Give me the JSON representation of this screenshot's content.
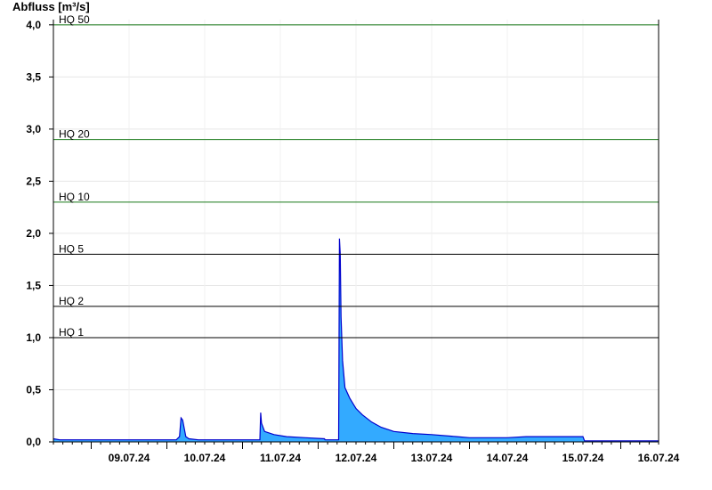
{
  "chart_data": {
    "type": "area",
    "ylabel": "Abfluss [m³/s]",
    "ylim": [
      0,
      4.05
    ],
    "x_range": [
      "08.07.24 12:00",
      "16.07.24 12:00"
    ],
    "y_ticks": [
      "0,0",
      "0,5",
      "1,0",
      "1,5",
      "2,0",
      "2,5",
      "3,0",
      "3,5",
      "4,0"
    ],
    "y_tick_values": [
      0,
      0.5,
      1.0,
      1.5,
      2.0,
      2.5,
      3.0,
      3.5,
      4.0
    ],
    "x_ticks": [
      "09.07.24",
      "10.07.24",
      "11.07.24",
      "12.07.24",
      "13.07.24",
      "14.07.24",
      "15.07.24",
      "16.07.24"
    ],
    "grid": true,
    "threshold_lines": [
      {
        "label": "HQ 50",
        "value": 4.0,
        "color": "#1a7a1a"
      },
      {
        "label": "HQ 20",
        "value": 2.9,
        "color": "#1a7a1a"
      },
      {
        "label": "HQ 10",
        "value": 2.3,
        "color": "#1a7a1a"
      },
      {
        "label": "HQ 5",
        "value": 1.8,
        "color": "#000000"
      },
      {
        "label": "HQ 2",
        "value": 1.3,
        "color": "#000000"
      },
      {
        "label": "HQ 1",
        "value": 1.0,
        "color": "#000000"
      }
    ],
    "series": [
      {
        "fill": "#33aaff",
        "stroke": "#0000cc",
        "x": [
          "08.07.24 12:00",
          "08.07.24 14:00",
          "10.07.24 03:00",
          "10.07.24 04:00",
          "10.07.24 04:30",
          "10.07.24 05:00",
          "10.07.24 06:00",
          "10.07.24 07:00",
          "10.07.24 10:00",
          "11.07.24 05:30",
          "11.07.24 05:45",
          "11.07.24 06:00",
          "11.07.24 07:00",
          "11.07.24 10:00",
          "11.07.24 14:00",
          "11.07.24 20:00",
          "12.07.24 02:00",
          "12.07.24 02:10",
          "12.07.24 05:00",
          "12.07.24 06:30",
          "12.07.24 06:45",
          "12.07.24 07:00",
          "12.07.24 07:15",
          "12.07.24 07:45",
          "12.07.24 08:30",
          "12.07.24 10:00",
          "12.07.24 12:00",
          "12.07.24 14:00",
          "12.07.24 17:00",
          "12.07.24 20:00",
          "13.07.24 00:00",
          "13.07.24 06:00",
          "13.07.24 12:00",
          "13.07.24 20:00",
          "14.07.24 00:00",
          "14.07.24 12:00",
          "14.07.24 18:00",
          "15.07.24 00:00",
          "15.07.24 12:00",
          "15.07.24 12:30",
          "16.07.24 12:00"
        ],
        "values": [
          0.03,
          0.02,
          0.02,
          0.05,
          0.23,
          0.21,
          0.05,
          0.03,
          0.02,
          0.02,
          0.28,
          0.18,
          0.1,
          0.07,
          0.05,
          0.04,
          0.03,
          0.02,
          0.02,
          0.02,
          1.95,
          1.8,
          1.2,
          0.78,
          0.52,
          0.42,
          0.32,
          0.26,
          0.19,
          0.14,
          0.1,
          0.08,
          0.07,
          0.05,
          0.04,
          0.04,
          0.05,
          0.05,
          0.05,
          0.01,
          0.01
        ]
      }
    ]
  }
}
